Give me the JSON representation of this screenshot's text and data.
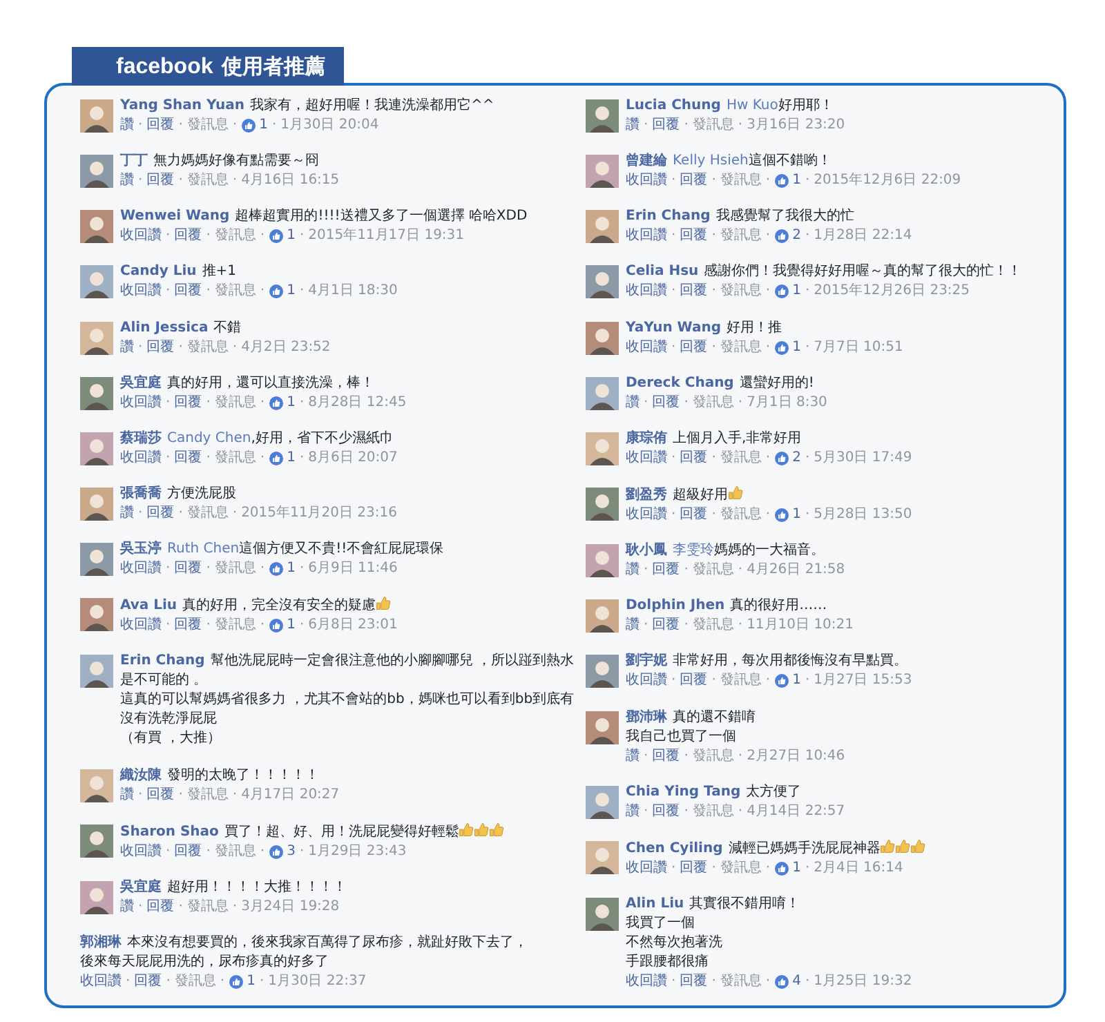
{
  "header": {
    "brand": "facebook",
    "title": "使用者推薦"
  },
  "separator": "·",
  "columns": [
    [
      {
        "kind": "with-avatar",
        "name": "Yang Shan Yuan",
        "text": "我家有，超好用喔！我連洗澡都用它^^",
        "actions": [
          "讚",
          "回覆",
          "發訊息"
        ],
        "likes": "1",
        "time": "1月30日 20:04"
      },
      {
        "kind": "with-avatar",
        "name": "丁丁",
        "text": "無力媽媽好像有點需要～冏",
        "actions": [
          "讚",
          "回覆",
          "發訊息"
        ],
        "time": "4月16日 16:15"
      },
      {
        "kind": "with-avatar",
        "name": "Wenwei Wang",
        "text": "超棒超實用的!!!!送禮又多了一個選擇 哈哈XDD",
        "actions": [
          "收回讚",
          "回覆",
          "發訊息"
        ],
        "likes": "1",
        "time": "2015年11月17日 19:31"
      },
      {
        "kind": "with-avatar",
        "name": "Candy Liu",
        "text": "推+1",
        "actions": [
          "收回讚",
          "回覆",
          "發訊息"
        ],
        "likes": "1",
        "time": "4月1日 18:30"
      },
      {
        "kind": "with-avatar",
        "name": "Alin Jessica",
        "text": "不錯",
        "actions": [
          "讚",
          "回覆",
          "發訊息"
        ],
        "time": "4月2日 23:52"
      },
      {
        "kind": "with-avatar",
        "name": "吳宜庭",
        "text": "真的好用，還可以直接洗澡，棒！",
        "actions": [
          "收回讚",
          "回覆",
          "發訊息"
        ],
        "likes": "1",
        "time": "8月28日 12:45"
      },
      {
        "kind": "with-avatar",
        "name": "蔡瑞莎",
        "tag": "Candy Chen",
        "text": ",好用，省下不少濕紙巾",
        "actions": [
          "收回讚",
          "回覆",
          "發訊息"
        ],
        "likes": "1",
        "time": "8月6日 20:07"
      },
      {
        "kind": "with-avatar",
        "name": "張喬喬",
        "text": "方便洗屁股",
        "actions": [
          "讚",
          "回覆",
          "發訊息"
        ],
        "time": "2015年11月20日 23:16"
      },
      {
        "kind": "with-avatar",
        "name": "吳玉渟",
        "tag": "Ruth Chen",
        "text": "這個方便又不貴!!不會紅屁屁環保",
        "actions": [
          "收回讚",
          "回覆",
          "發訊息"
        ],
        "likes": "1",
        "time": "6月9日 11:46"
      },
      {
        "kind": "with-avatar",
        "name": "Ava Liu",
        "text": "真的好用，完全沒有安全的疑慮",
        "emojis": [
          {
            "kind": "thumbs-up"
          }
        ],
        "actions": [
          "收回讚",
          "回覆",
          "發訊息"
        ],
        "likes": "1",
        "time": "6月8日 23:01"
      },
      {
        "kind": "with-avatar",
        "name": "Erin Chang",
        "text": "幫他洗屁屁時一定會很注意他的小腳腳哪兒 ，所以踫到熱水",
        "more_lines": [
          "是不可能的 。",
          "這真的可以幫媽媽省很多力 ，尤其不會站的bb，媽咪也可以看到bb到底有沒有洗乾淨屁屁",
          "（有買 ，大推）"
        ]
      },
      {
        "kind": "with-avatar",
        "name": "織汝陳",
        "text": "發明的太晚了！！！！！",
        "actions": [
          "讚",
          "回覆",
          "發訊息"
        ],
        "time": "4月17日 20:27"
      },
      {
        "kind": "with-avatar",
        "name": "Sharon Shao",
        "text": "買了！超、好、用！洗屁屁變得好輕鬆",
        "emojis": [
          {
            "kind": "thumbs-up"
          },
          {
            "kind": "thumbs-up"
          },
          {
            "kind": "thumbs-up"
          }
        ],
        "actions": [
          "收回讚",
          "回覆",
          "發訊息"
        ],
        "likes": "3",
        "time": "1月29日 23:43"
      },
      {
        "kind": "with-avatar",
        "name": "吳宜庭",
        "text": "超好用！！！！大推！！！！",
        "actions": [
          "讚",
          "回覆",
          "發訊息"
        ],
        "time": "3月24日 19:28"
      },
      {
        "kind": "text-only",
        "name": "郭湘琳",
        "text": "本來沒有想要買的，後來我家百萬得了尿布疹，就趾好敗下去了，",
        "more_lines": [
          "後來每天屁屁用洗的，尿布疹真的好多了"
        ],
        "actions": [
          "收回讚",
          "回覆",
          "發訊息"
        ],
        "likes": "1",
        "time": "1月30日 22:37"
      }
    ],
    [
      {
        "kind": "with-avatar",
        "name": "Lucia Chung",
        "tag": "Hw Kuo",
        "text": "好用耶！",
        "actions": [
          "讚",
          "回覆",
          "發訊息"
        ],
        "time": "3月16日 23:20"
      },
      {
        "kind": "with-avatar",
        "name": "曾建綸",
        "tag": "Kelly Hsieh",
        "text": "這個不錯喲！",
        "actions": [
          "收回讚",
          "回覆",
          "發訊息"
        ],
        "likes": "1",
        "time": "2015年12月6日 22:09"
      },
      {
        "kind": "with-avatar",
        "name": "Erin Chang",
        "text": "我感覺幫了我很大的忙",
        "actions": [
          "收回讚",
          "回覆",
          "發訊息"
        ],
        "likes": "2",
        "time": "1月28日 22:14"
      },
      {
        "kind": "with-avatar",
        "name": "Celia Hsu",
        "text": "感謝你們！我覺得好好用喔～真的幫了很大的忙！！",
        "actions": [
          "收回讚",
          "回覆",
          "發訊息"
        ],
        "likes": "1",
        "time": "2015年12月26日 23:25"
      },
      {
        "kind": "with-avatar",
        "name": "YaYun Wang",
        "text": "好用！推",
        "actions": [
          "收回讚",
          "回覆",
          "發訊息"
        ],
        "likes": "1",
        "time": "7月7日 10:51"
      },
      {
        "kind": "with-avatar",
        "name": "Dereck Chang",
        "text": "還蠻好用的!",
        "actions": [
          "讚",
          "回覆",
          "發訊息"
        ],
        "time": "7月1日 8:30"
      },
      {
        "kind": "with-avatar",
        "name": "康琮侑",
        "text": "上個月入手,非常好用",
        "actions": [
          "收回讚",
          "回覆",
          "發訊息"
        ],
        "likes": "2",
        "time": "5月30日 17:49"
      },
      {
        "kind": "with-avatar",
        "name": "劉盈秀",
        "text": "超級好用",
        "emojis": [
          {
            "kind": "thumbs-up"
          }
        ],
        "actions": [
          "收回讚",
          "回覆",
          "發訊息"
        ],
        "likes": "1",
        "time": "5月28日 13:50"
      },
      {
        "kind": "with-avatar",
        "name": "耿小鳳",
        "tag": "李雯玲",
        "text": "媽媽的一大福音。",
        "actions": [
          "讚",
          "回覆",
          "發訊息"
        ],
        "time": "4月26日 21:58"
      },
      {
        "kind": "with-avatar",
        "name": "Dolphin Jhen",
        "text": "真的很好用……",
        "actions": [
          "讚",
          "回覆",
          "發訊息"
        ],
        "time": "11月10日 10:21"
      },
      {
        "kind": "with-avatar",
        "name": "劉宇妮",
        "text": "非常好用，每次用都後悔沒有早點買。",
        "actions": [
          "收回讚",
          "回覆",
          "發訊息"
        ],
        "likes": "1",
        "time": "1月27日 15:53"
      },
      {
        "kind": "with-avatar",
        "name": "鄧沛琳",
        "text": "真的還不錯唷",
        "more_lines": [
          "我自己也買了一個"
        ],
        "actions": [
          "讚",
          "回覆",
          "發訊息"
        ],
        "time": "2月27日 10:46"
      },
      {
        "kind": "with-avatar",
        "name": "Chia Ying Tang",
        "text": "太方便了",
        "actions": [
          "讚",
          "回覆",
          "發訊息"
        ],
        "time": "4月14日 22:57"
      },
      {
        "kind": "with-avatar",
        "name": "Chen Cyiling",
        "text": "減輕已媽媽手洗屁屁神器",
        "emojis": [
          {
            "kind": "thumbs-up"
          },
          {
            "kind": "thumbs-up"
          },
          {
            "kind": "thumbs-up"
          }
        ],
        "actions": [
          "收回讚",
          "回覆",
          "發訊息"
        ],
        "likes": "1",
        "time": "2月4日 16:14"
      },
      {
        "kind": "with-avatar",
        "name": "Alin Liu",
        "text": "其實很不錯用唷！",
        "more_lines": [
          "我買了一個",
          "不然每次抱著洗",
          "手跟腰都很痛"
        ],
        "actions": [
          "收回讚",
          "回覆",
          "發訊息"
        ],
        "likes": "4",
        "time": "1月25日 19:32"
      }
    ]
  ]
}
